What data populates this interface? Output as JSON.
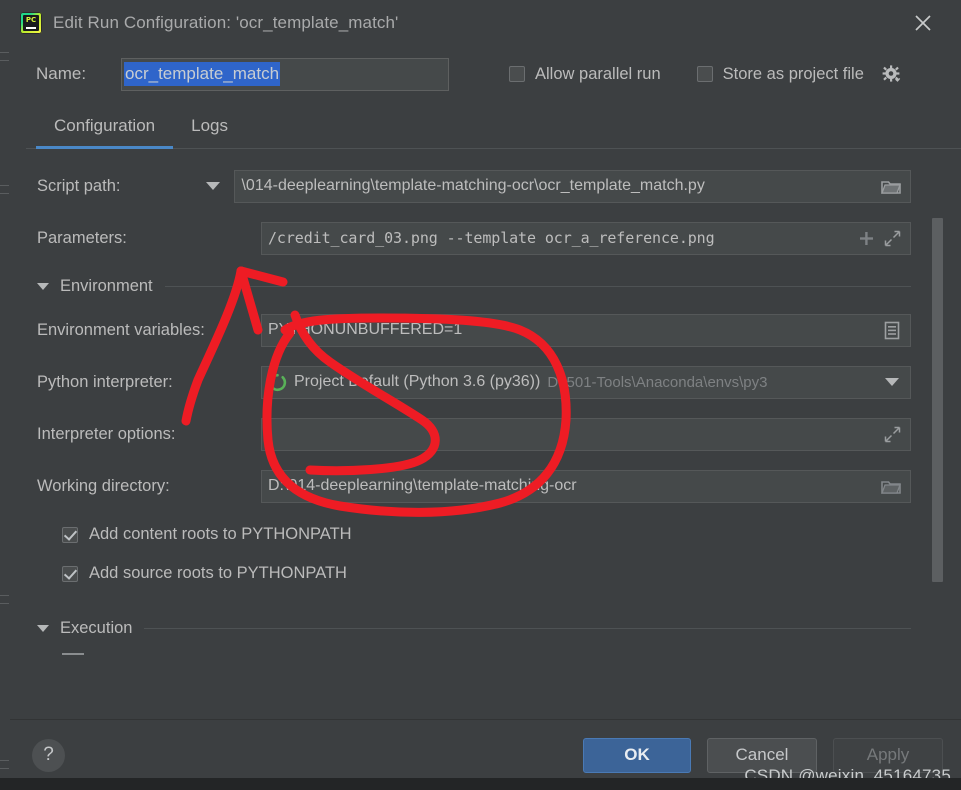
{
  "window": {
    "app_icon": "pycharm-icon",
    "title": "Edit Run Configuration: 'ocr_template_match'",
    "close_icon": "close-icon"
  },
  "name_row": {
    "label": "Name:",
    "value": "ocr_template_match",
    "allow_parallel_run": {
      "label": "Allow parallel run",
      "checked": false
    },
    "store_as_project_file": {
      "label": "Store as project file",
      "checked": false,
      "gear_icon": "gear-icon"
    }
  },
  "tabs": [
    {
      "label": "Configuration",
      "active": true
    },
    {
      "label": "Logs",
      "active": false
    }
  ],
  "form": {
    "script_path": {
      "label": "Script path:",
      "value": "\\014-deeplearning\\template-matching-ocr\\ocr_template_match.py",
      "dropdown_icon": "chevron-down-icon",
      "browse_icon": "folder-icon"
    },
    "parameters": {
      "label": "Parameters:",
      "value": "/credit_card_03.png --template ocr_a_reference.png",
      "insert_icon": "plus-icon",
      "expand_icon": "expand-icon"
    },
    "environment_section": {
      "label": "Environment",
      "collapse_icon": "triangle-down-icon"
    },
    "environment_variables": {
      "label": "Environment variables:",
      "value": "PYTHONUNBUFFERED=1",
      "edit_icon": "list-edit-icon"
    },
    "python_interpreter": {
      "label": "Python interpreter:",
      "value": "Project Default (Python 3.6 (py36))",
      "path": "D:\\501-Tools\\Anaconda\\envs\\py3",
      "status_icon": "python-env-icon",
      "dropdown_icon": "chevron-down-icon"
    },
    "interpreter_options": {
      "label": "Interpreter options:",
      "value": "",
      "expand_icon": "expand-icon"
    },
    "working_directory": {
      "label": "Working directory:",
      "value": "D:\\014-deeplearning\\template-matching-ocr",
      "browse_icon": "folder-icon"
    },
    "add_content_roots": {
      "label": "Add content roots to PYTHONPATH",
      "checked": true
    },
    "add_source_roots": {
      "label": "Add source roots to PYTHONPATH",
      "checked": true
    },
    "execution_section": {
      "label": "Execution",
      "collapse_icon": "triangle-down-icon"
    }
  },
  "footer": {
    "help_label": "?",
    "ok_label": "OK",
    "cancel_label": "Cancel",
    "apply_label": "Apply"
  },
  "watermark": "CSDN @weixin_45164735",
  "colors": {
    "dialog_bg": "#3c3f41",
    "field_bg": "#45494a",
    "text": "#bbbbbb",
    "accent_tab": "#4a88c7",
    "ok_button": "#3c6498",
    "selection": "#2f65ca",
    "annotation": "#ee1c24",
    "env_icon_green": "#59b158"
  }
}
